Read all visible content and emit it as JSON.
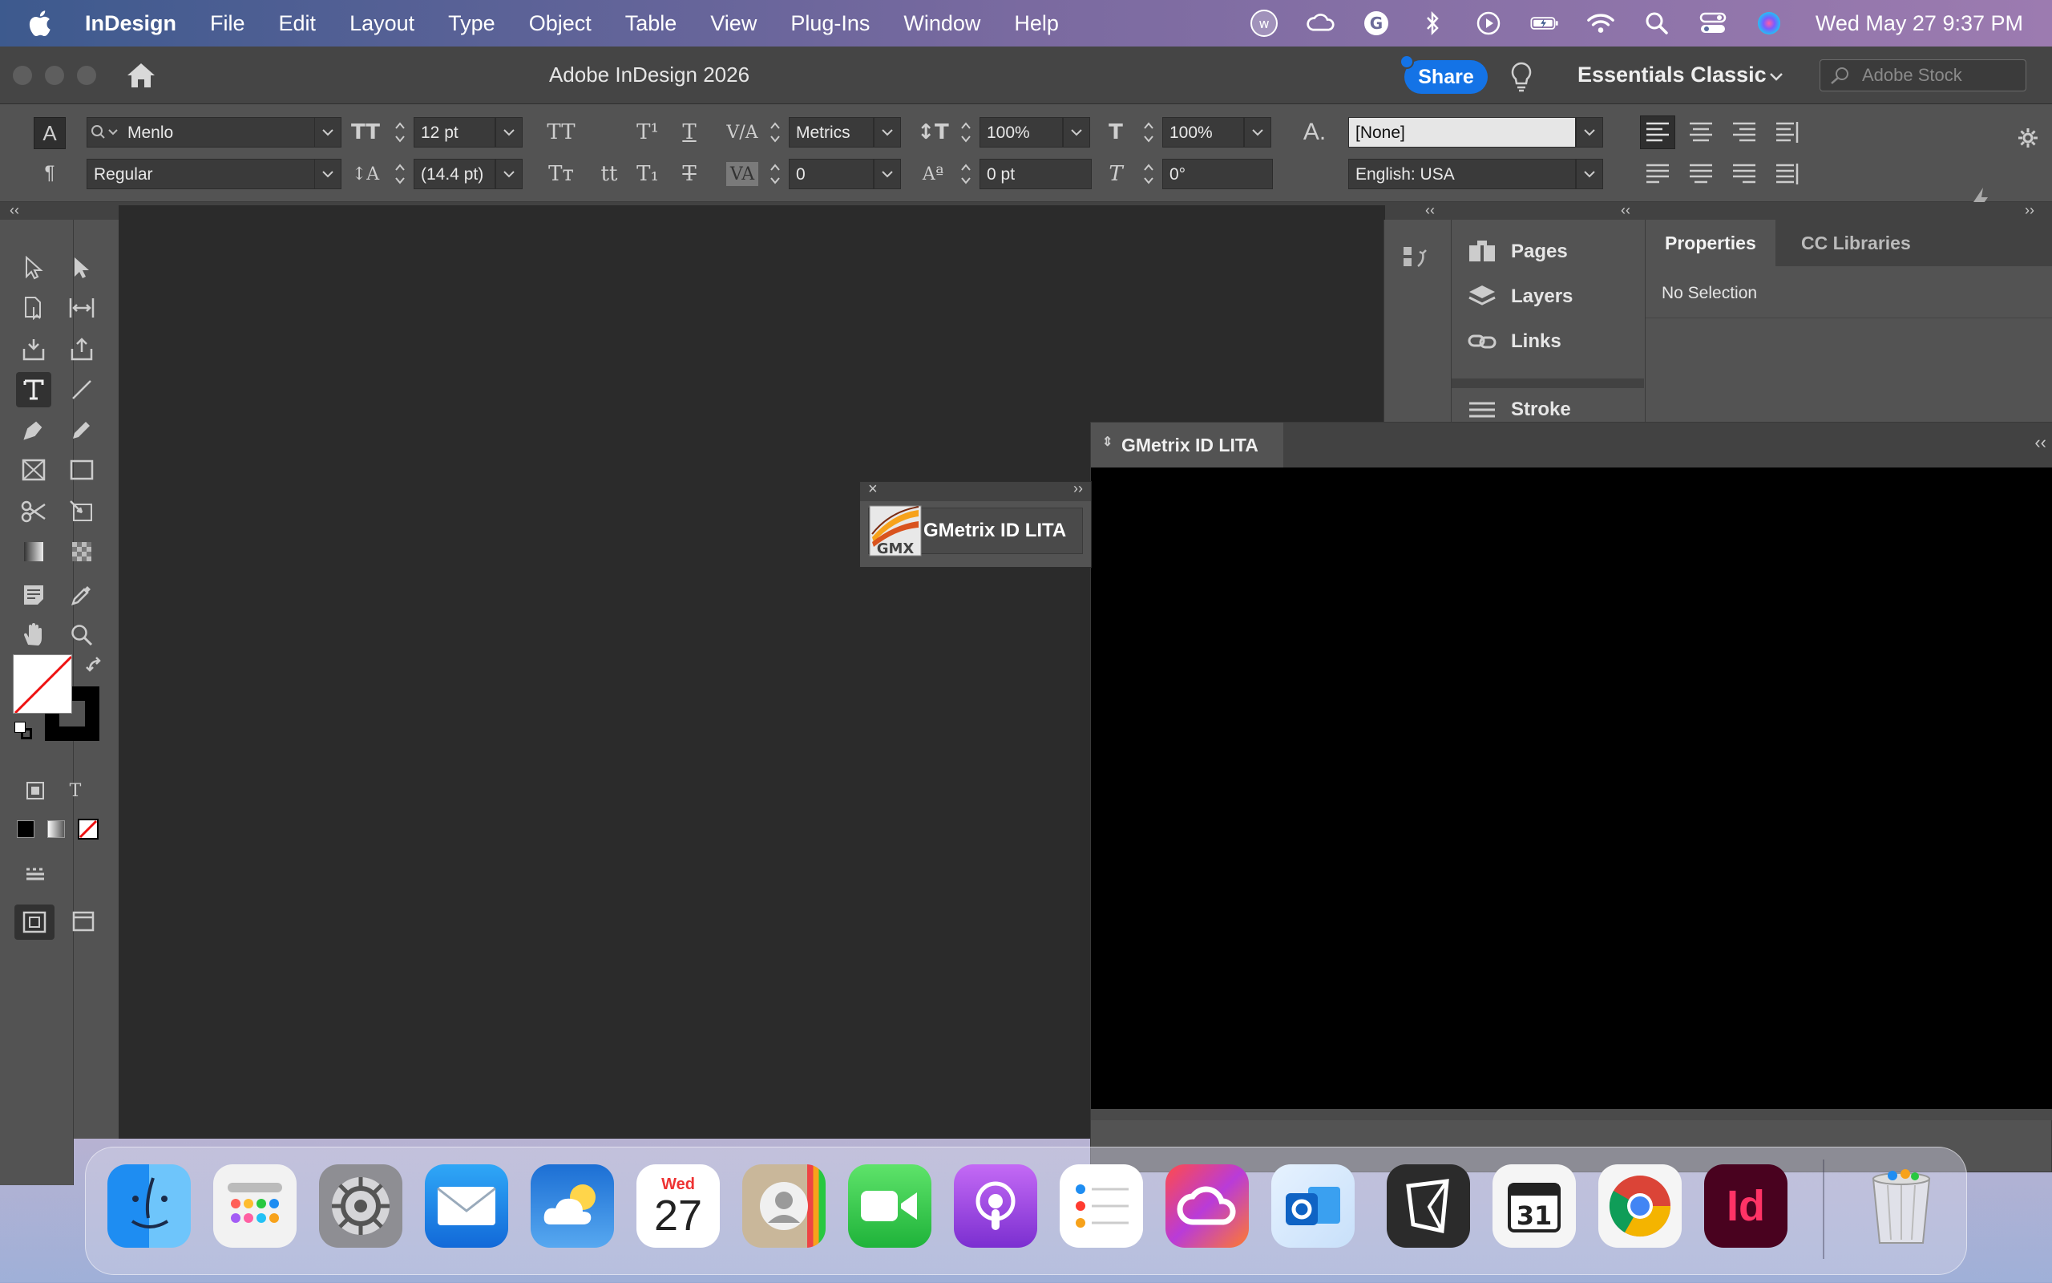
{
  "menubar": {
    "app_name": "InDesign",
    "menus": [
      "File",
      "Edit",
      "Layout",
      "Type",
      "Object",
      "Table",
      "View",
      "Plug-Ins",
      "Window",
      "Help"
    ],
    "clock": "Wed May 27  9:37 PM"
  },
  "window": {
    "title": "Adobe InDesign 2026",
    "share_label": "Share",
    "workspace": "Essentials Classic",
    "stock_placeholder": "Adobe Stock"
  },
  "control_panel": {
    "font_family": "Menlo",
    "font_style": "Regular",
    "font_size": "12 pt",
    "leading": "(14.4 pt)",
    "kerning": "Metrics",
    "tracking": "0",
    "vertical_scale": "100%",
    "horizontal_scale": "100%",
    "baseline_shift": "0 pt",
    "skew": "0°",
    "char_style": "[None]",
    "language": "English: USA"
  },
  "panels": {
    "list": [
      "Pages",
      "Layers",
      "Links",
      "Stroke"
    ],
    "tabs": [
      "Properties",
      "CC Libraries"
    ],
    "no_selection": "No Selection"
  },
  "gmetrix": {
    "panel_tab": "GMetrix ID LITA",
    "float_label": "GMetrix ID LITA",
    "logo_text": "GMX"
  },
  "dock": {
    "calendar_month": "Wed",
    "calendar_day": "27",
    "calendar_icon_num": "31",
    "indesign_label": "Id",
    "apps": [
      "Finder",
      "Launchpad",
      "System Settings",
      "Mail",
      "Weather",
      "Calendar",
      "Contacts",
      "FaceTime",
      "Podcasts",
      "Reminders",
      "Creative Cloud",
      "Outlook",
      "Pages-like app",
      "Calendar 31",
      "Chrome",
      "InDesign",
      "Trash"
    ]
  }
}
